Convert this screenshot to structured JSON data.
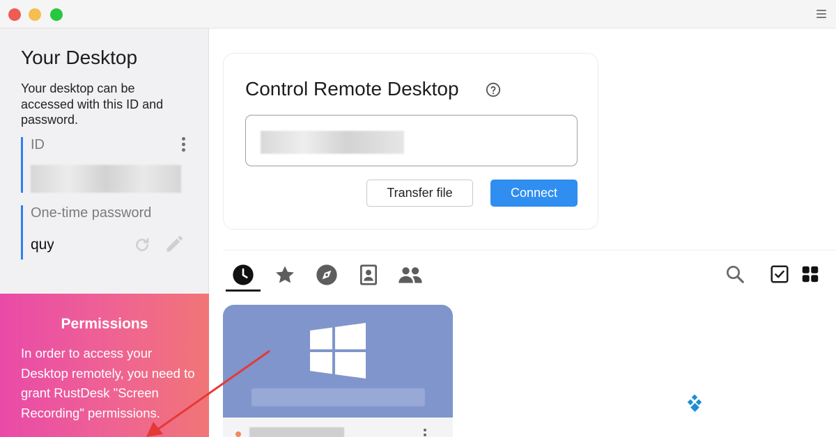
{
  "window": {
    "controls": [
      "close",
      "minimize",
      "zoom"
    ],
    "menu_icon": "hamburger-menu-icon"
  },
  "sidebar": {
    "title": "Your Desktop",
    "description": "Your desktop can be accessed with this ID and password.",
    "id_label": "ID",
    "password_label": "One-time password",
    "password_value": "quy",
    "icons": [
      "more-vertical-icon",
      "refresh-icon",
      "edit-pencil-icon"
    ]
  },
  "permissions": {
    "title": "Permissions",
    "text": "In order to access your Desktop remotely, you need to grant RustDesk \"Screen Recording\" permissions."
  },
  "control_card": {
    "title": "Control Remote Desktop",
    "help_icon": "help-circle-icon",
    "transfer_label": "Transfer file",
    "connect_label": "Connect"
  },
  "tabs": [
    {
      "name": "recent",
      "icon": "clock-icon",
      "selected": true
    },
    {
      "name": "favorites",
      "icon": "star-icon",
      "selected": false
    },
    {
      "name": "discovered",
      "icon": "compass-icon",
      "selected": false
    },
    {
      "name": "address-book",
      "icon": "contact-book-icon",
      "selected": false
    },
    {
      "name": "group",
      "icon": "people-icon",
      "selected": false
    }
  ],
  "toolbar": [
    "search-icon",
    "checkbox-select-icon",
    "grid-view-icon"
  ],
  "peer": {
    "os_icon": "windows-logo-icon"
  },
  "colors": {
    "accent": "#2f8ef0",
    "permission_gradient": [
      "#e94aa8",
      "#f17577"
    ],
    "peer_card": "#7f95cc",
    "annotation_arrow": "#e53935"
  }
}
